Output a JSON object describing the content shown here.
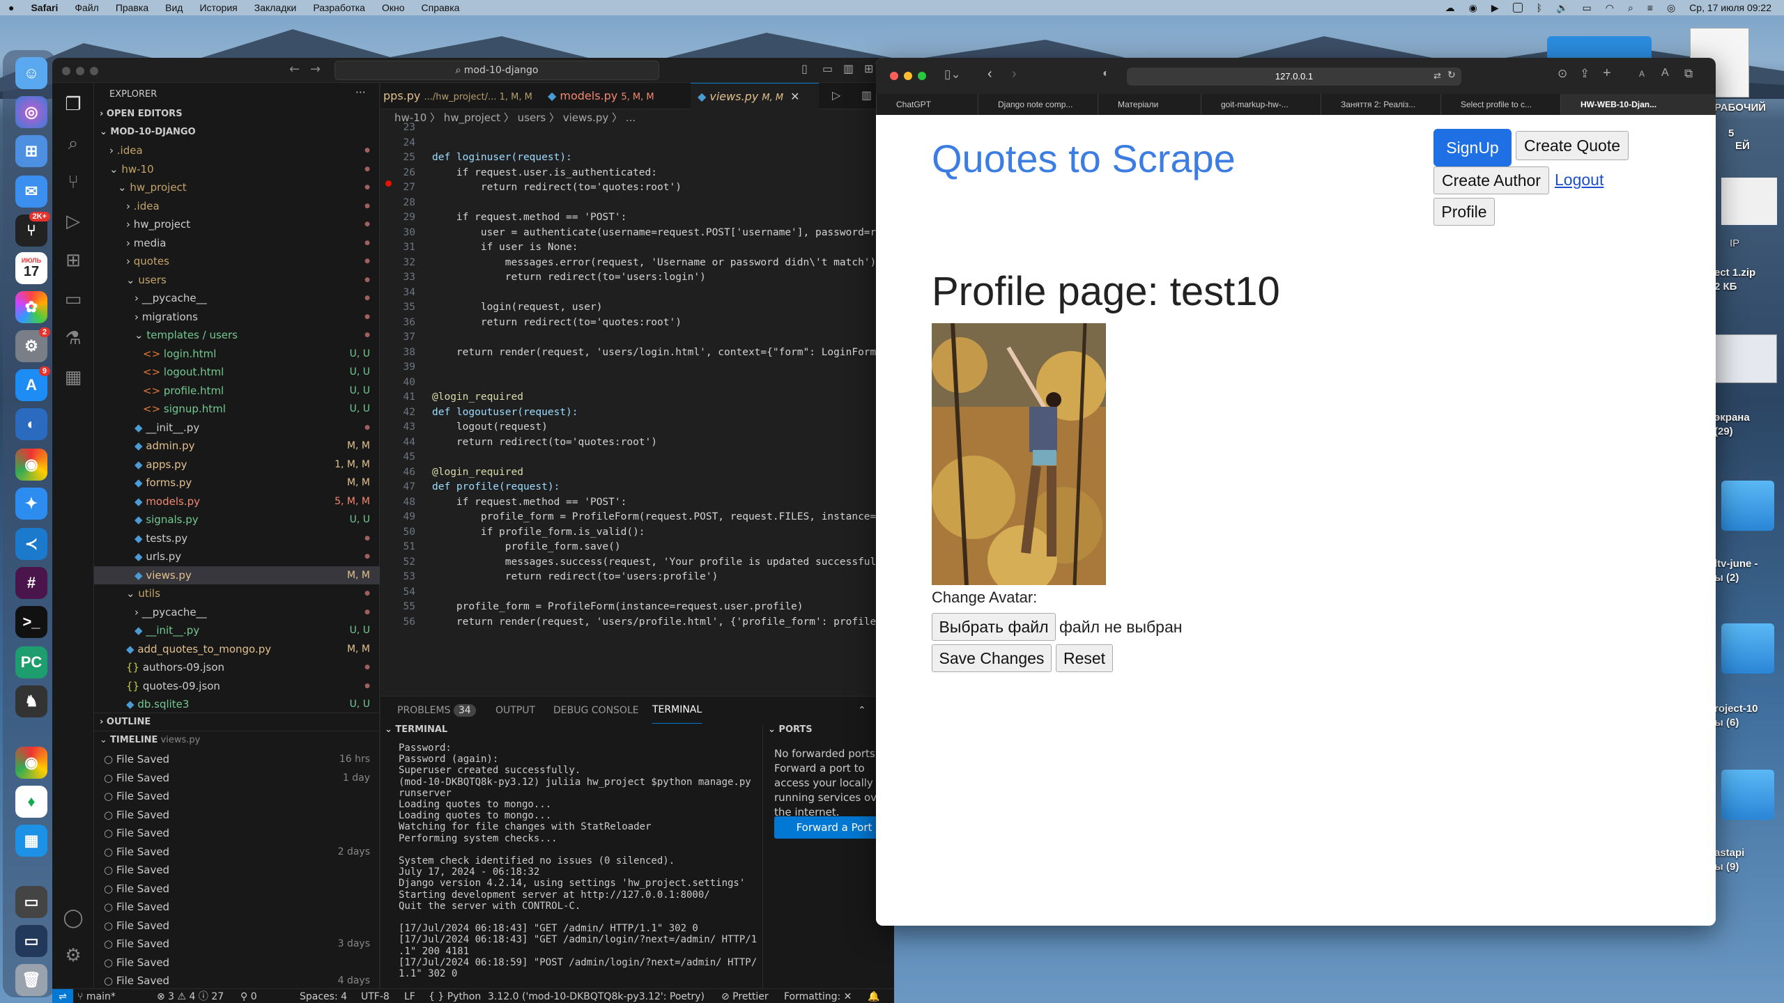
{
  "menubar": {
    "app": "Safari",
    "items": [
      "Файл",
      "Правка",
      "Вид",
      "История",
      "Закладки",
      "Разработка",
      "Окно",
      "Справка"
    ],
    "datetime": "Ср, 17 июля  09:22"
  },
  "dock": {
    "calendar_month": "ИЮЛЬ",
    "calendar_day": "17",
    "mail_badge": "2K+",
    "settings_badge": "2",
    "appstore_badge": "9"
  },
  "desktop": {
    "labels": [
      "ect 1.zip",
      "2 КБ",
      "экрана",
      "(29)",
      "ltv-june -",
      "ы (2)",
      "roject-10",
      "ы (6)",
      "astapi",
      "ы (9)",
      "РАБОЧИЙ",
      "5",
      "ЕЙ",
      "IP"
    ]
  },
  "vscode": {
    "search": "mod-10-django",
    "explorer_title": "EXPLORER",
    "open_editors": "OPEN EDITORS",
    "project": "MOD-10-DJANGO",
    "tree": [
      {
        "name": ".idea",
        "st": "",
        "c": "#c5a56a"
      },
      {
        "name": "hw-10",
        "st": "",
        "c": "#c5a56a"
      },
      {
        "name": "hw_project",
        "st": "",
        "c": "#c5a56a"
      },
      {
        "name": ".idea",
        "st": "",
        "c": "#c5a56a"
      },
      {
        "name": "hw_project",
        "st": "",
        "c": "#ccc"
      },
      {
        "name": "media",
        "st": "",
        "c": "#ccc"
      },
      {
        "name": "quotes",
        "st": "",
        "c": "#c5a56a"
      },
      {
        "name": "users",
        "st": "",
        "c": "#c5a56a"
      },
      {
        "name": "__pycache__",
        "st": "",
        "c": "#ccc"
      },
      {
        "name": "migrations",
        "st": "",
        "c": "#ccc"
      },
      {
        "name": "templates / users",
        "st": "",
        "c": "#73c991"
      },
      {
        "name": "login.html",
        "st": "U, U",
        "c": "#73c991"
      },
      {
        "name": "logout.html",
        "st": "U, U",
        "c": "#73c991"
      },
      {
        "name": "profile.html",
        "st": "U, U",
        "c": "#73c991"
      },
      {
        "name": "signup.html",
        "st": "U, U",
        "c": "#73c991"
      },
      {
        "name": "__init__.py",
        "st": "",
        "c": "#ccc"
      },
      {
        "name": "admin.py",
        "st": "M, M",
        "c": "#e2c08d"
      },
      {
        "name": "apps.py",
        "st": "1, M, M",
        "c": "#e2c08d"
      },
      {
        "name": "forms.py",
        "st": "M, M",
        "c": "#e2c08d"
      },
      {
        "name": "models.py",
        "st": "5, M, M",
        "c": "#f48771"
      },
      {
        "name": "signals.py",
        "st": "U, U",
        "c": "#73c991"
      },
      {
        "name": "tests.py",
        "st": "",
        "c": "#ccc"
      },
      {
        "name": "urls.py",
        "st": "",
        "c": "#ccc"
      },
      {
        "name": "views.py",
        "st": "M, M",
        "c": "#e2c08d"
      },
      {
        "name": "utils",
        "st": "",
        "c": "#c5a56a"
      },
      {
        "name": "__pycache__",
        "st": "",
        "c": "#ccc"
      },
      {
        "name": "__init__.py",
        "st": "U, U",
        "c": "#73c991"
      },
      {
        "name": "add_quotes_to_mongo.py",
        "st": "M, M",
        "c": "#e2c08d"
      },
      {
        "name": "authors-09.json",
        "st": "",
        "c": "#ccc"
      },
      {
        "name": "quotes-09.json",
        "st": "",
        "c": "#ccc"
      },
      {
        "name": "db.sqlite3",
        "st": "U, U",
        "c": "#73c991"
      }
    ],
    "outline": "OUTLINE",
    "timeline": "TIMELINE",
    "timeline_file": "views.py",
    "timeline_items": [
      {
        "label": "File Saved",
        "time": "16 hrs"
      },
      {
        "label": "File Saved",
        "time": "1 day"
      },
      {
        "label": "File Saved",
        "time": ""
      },
      {
        "label": "File Saved",
        "time": ""
      },
      {
        "label": "File Saved",
        "time": ""
      },
      {
        "label": "File Saved",
        "time": "2 days"
      },
      {
        "label": "File Saved",
        "time": ""
      },
      {
        "label": "File Saved",
        "time": ""
      },
      {
        "label": "File Saved",
        "time": ""
      },
      {
        "label": "File Saved",
        "time": ""
      },
      {
        "label": "File Saved",
        "time": "3 days"
      },
      {
        "label": "File Saved",
        "time": ""
      },
      {
        "label": "File Saved",
        "time": "4 days"
      }
    ],
    "tabs": [
      {
        "label": "pps.py",
        "extra": ".../hw_project/... 1, M, M"
      },
      {
        "label": "models.py",
        "extra": "5, M, M"
      },
      {
        "label": "views.py",
        "extra": "M, M"
      }
    ],
    "breadcrumb": "hw-10  〉 hw_project 〉 users 〉  views.py 〉 ...",
    "code": [
      {
        "n": "23",
        "t": ""
      },
      {
        "n": "24",
        "t": ""
      },
      {
        "n": "25",
        "t": "def loginuser(request):"
      },
      {
        "n": "26",
        "t": "    if request.user.is_authenticated:"
      },
      {
        "n": "27",
        "t": "        return redirect(to='quotes:root')"
      },
      {
        "n": "28",
        "t": ""
      },
      {
        "n": "29",
        "t": "    if request.method == 'POST':"
      },
      {
        "n": "30",
        "t": "        user = authenticate(username=request.POST['username'], password=request.P"
      },
      {
        "n": "31",
        "t": "        if user is None:"
      },
      {
        "n": "32",
        "t": "            messages.error(request, 'Username or password didn\\'t match')"
      },
      {
        "n": "33",
        "t": "            return redirect(to='users:login')"
      },
      {
        "n": "34",
        "t": ""
      },
      {
        "n": "35",
        "t": "        login(request, user)"
      },
      {
        "n": "36",
        "t": "        return redirect(to='quotes:root')"
      },
      {
        "n": "37",
        "t": ""
      },
      {
        "n": "38",
        "t": "    return render(request, 'users/login.html', context={\"form\": LoginForm()})"
      },
      {
        "n": "39",
        "t": ""
      },
      {
        "n": "40",
        "t": ""
      },
      {
        "n": "41",
        "t": "@login_required"
      },
      {
        "n": "42",
        "t": "def logoutuser(request):"
      },
      {
        "n": "43",
        "t": "    logout(request)"
      },
      {
        "n": "44",
        "t": "    return redirect(to='quotes:root')"
      },
      {
        "n": "45",
        "t": ""
      },
      {
        "n": "46",
        "t": "@login_required"
      },
      {
        "n": "47",
        "t": "def profile(request):"
      },
      {
        "n": "48",
        "t": "    if request.method == 'POST':"
      },
      {
        "n": "49",
        "t": "        profile_form = ProfileForm(request.POST, request.FILES, instance=request."
      },
      {
        "n": "50",
        "t": "        if profile_form.is_valid():"
      },
      {
        "n": "51",
        "t": "            profile_form.save()"
      },
      {
        "n": "52",
        "t": "            messages.success(request, 'Your profile is updated successfully')"
      },
      {
        "n": "53",
        "t": "            return redirect(to='users:profile')"
      },
      {
        "n": "54",
        "t": ""
      },
      {
        "n": "55",
        "t": "    profile_form = ProfileForm(instance=request.user.profile)"
      },
      {
        "n": "56",
        "t": "    return render(request, 'users/profile.html', {'profile_form': profile_form})"
      }
    ],
    "panel_tabs": [
      "PROBLEMS",
      "OUTPUT",
      "DEBUG CONSOLE",
      "TERMINAL"
    ],
    "problems_count": "34",
    "terminal_header": "TERMINAL",
    "ports_header": "PORTS",
    "terminal": [
      "Password:",
      "Password (again):",
      "Superuser created successfully.",
      "(mod-10-DKBQTQ8k-py3.12) juliia hw_project $python manage.py",
      "runserver",
      "Loading quotes to mongo...",
      "Loading quotes to mongo...",
      "Watching for file changes with StatReloader",
      "Performing system checks...",
      "",
      "System check identified no issues (0 silenced).",
      "July 17, 2024 - 06:18:32",
      "Django version 4.2.14, using settings 'hw_project.settings'",
      "Starting development server at http://127.0.0.1:8000/",
      "Quit the server with CONTROL-C.",
      "",
      "[17/Jul/2024 06:18:43] \"GET /admin/ HTTP/1.1\" 302 0",
      "[17/Jul/2024 06:18:43] \"GET /admin/login/?next=/admin/ HTTP/1",
      ".1\" 200 4181",
      "[17/Jul/2024 06:18:59] \"POST /admin/login/?next=/admin/ HTTP/",
      "1.1\" 302 0"
    ],
    "ports_text": "No forwarded ports. Forward a port to access your locally running services over the internet.",
    "forward_button": "Forward a Port",
    "status": {
      "branch": "main*",
      "errors": "⊗ 3 ⚠ 4 ⓘ 27",
      "ports": "⚲ 0",
      "spaces": "Spaces: 4",
      "encoding": "UTF-8",
      "eol": "LF",
      "lang": "{ } Python",
      "interp": "3.12.0 ('mod-10-DKBQTQ8k-py3.12': Poetry)",
      "prettier": "⊘ Prettier",
      "formatting": "Formatting: ✕"
    }
  },
  "safari": {
    "url": "127.0.0.1",
    "tabs": [
      "ChatGPT",
      "Django note comp...",
      "Матеріали",
      "goit-markup-hw-...",
      "Заняття 2: Реаліз...",
      "Select profile to c...",
      "HW-WEB-10-Djan..."
    ],
    "page": {
      "site_title": "Quotes to Scrape",
      "nav": {
        "signup": "SignUp",
        "create_quote": "Create Quote",
        "create_author": "Create Author",
        "logout": "Logout",
        "profile": "Profile"
      },
      "heading": "Profile page: test10",
      "change_avatar": "Change Avatar:",
      "choose_file": "Выбрать файл",
      "no_file": "файл не выбран",
      "save": "Save Changes",
      "reset": "Reset"
    }
  }
}
